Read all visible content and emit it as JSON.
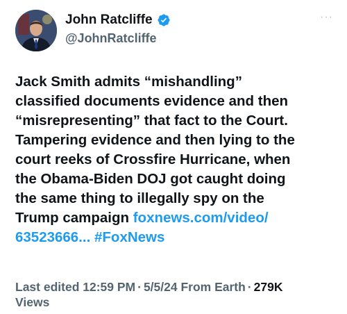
{
  "author": {
    "name": "John Ratcliffe",
    "handle": "@JohnRatcliffe",
    "verified": true,
    "avatar_icon": "profile-photo",
    "verified_icon": "verified-badge-icon",
    "verified_color": "#1d9bf0"
  },
  "menu": {
    "icon": "more-options-icon",
    "glyph": "···"
  },
  "tweet": {
    "lines": [
      "Jack Smith admits “mishandling”",
      "classified documents evidence and then",
      "“misrepresenting” that fact to the Court.",
      "Tampering evidence and then lying to the",
      "court reeks of Crossfire Hurricane, when",
      "the Obama-Biden DOJ got caught doing",
      "the same thing to illegally spy on the"
    ],
    "line8_text": "Trump campaign ",
    "link_url": "foxnews.com/video/",
    "link_url_cont": "63523666...",
    "hashtag": "#FoxNews",
    "link_color": "#1d9bf0"
  },
  "meta": {
    "edited_label": "Last edited 12:59 PM",
    "date": "5/5/24",
    "location": "From Earth",
    "views_count": "279K",
    "views_label": "Views",
    "separator": "·"
  }
}
